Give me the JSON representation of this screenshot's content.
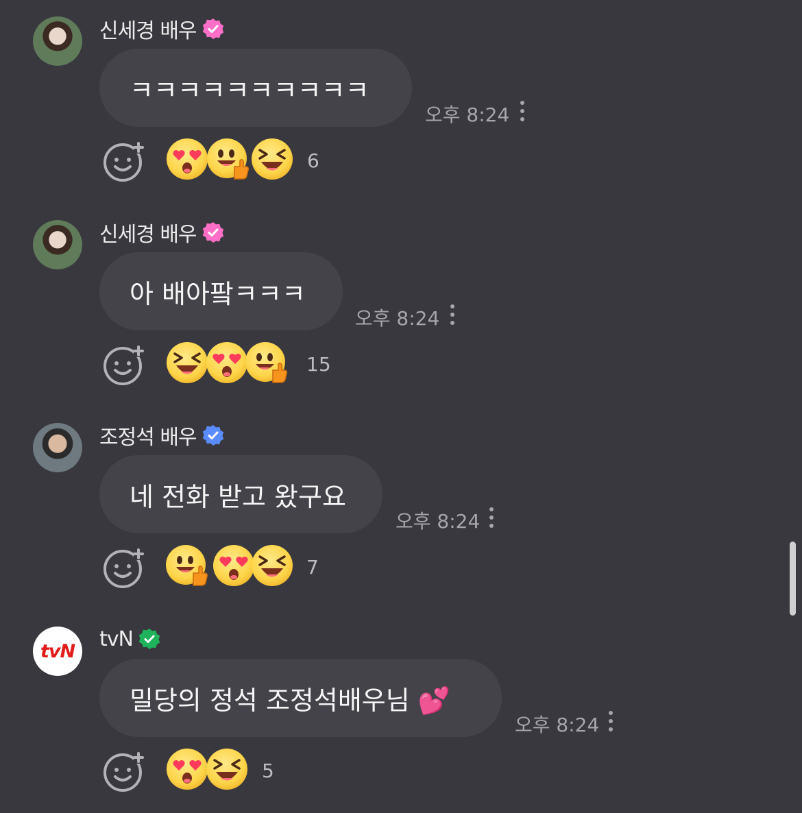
{
  "messages": [
    {
      "author": "신세경 배우",
      "badge_color": "#ff6fc8",
      "text": "ㅋㅋㅋㅋㅋㅋㅋㅋㅋㅋ",
      "time": "오후 8:24",
      "reactions": [
        "heart-eyes",
        "thumbs-up-smile",
        "laughing"
      ],
      "reaction_count": "6"
    },
    {
      "author": "신세경 배우",
      "badge_color": "#ff6fc8",
      "text": "아 배아팤ㅋㅋㅋ",
      "time": "오후 8:24",
      "reactions": [
        "laughing",
        "heart-eyes",
        "thumbs-up-smile"
      ],
      "reaction_count": "15"
    },
    {
      "author": "조정석 배우",
      "badge_color": "#5b8cff",
      "text": "네 전화 받고 왔구요",
      "time": "오후 8:24",
      "reactions": [
        "thumbs-up-smile",
        "heart-eyes",
        "laughing"
      ],
      "reaction_count": "7"
    },
    {
      "author": "tvN",
      "badge_color": "#1fb35c",
      "avatar_text": "tvN",
      "text": "밀당의 정석 조정석배우님 💕",
      "time": "오후 8:24",
      "reactions": [
        "heart-eyes",
        "laughing"
      ],
      "reaction_count": "5"
    }
  ],
  "colors": {
    "background": "#39383e",
    "bubble": "#444349",
    "meta_text": "#a7a6ab"
  }
}
